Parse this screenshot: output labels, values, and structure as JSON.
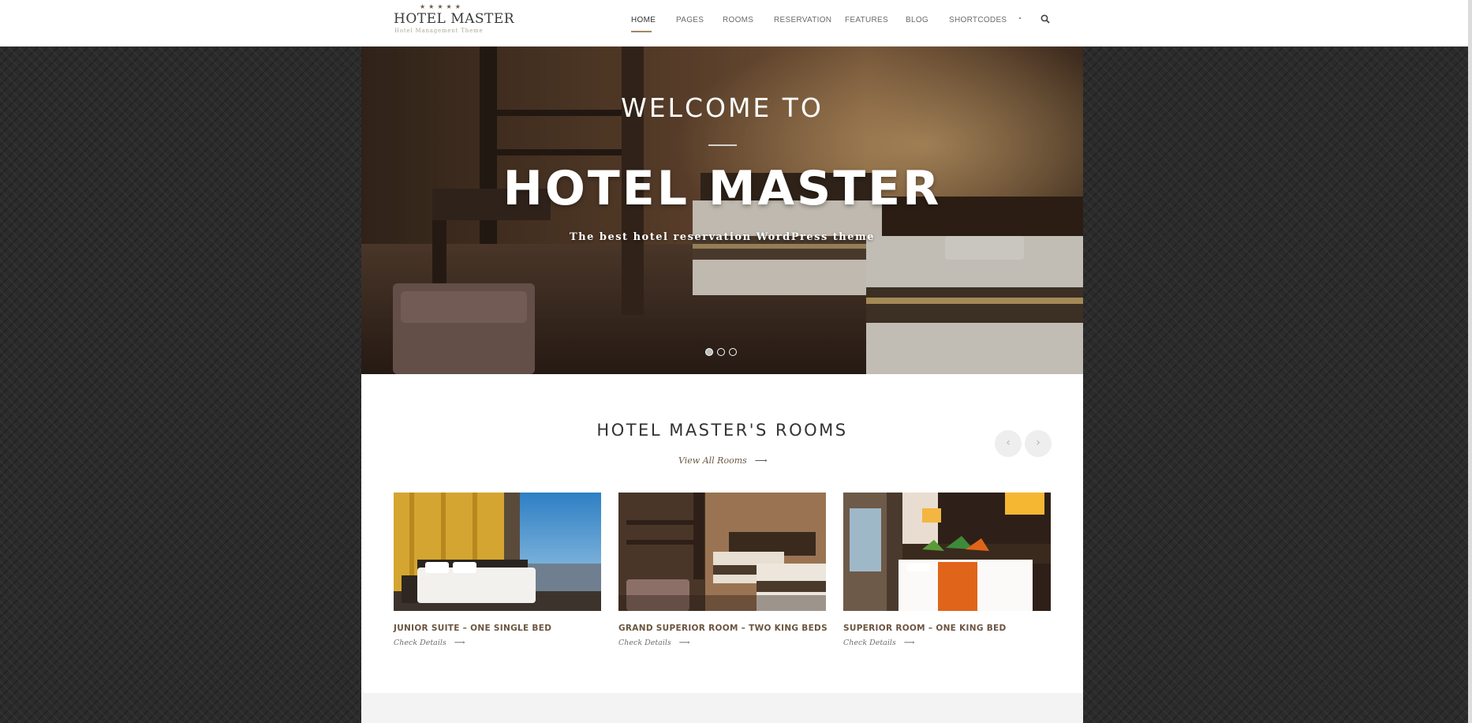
{
  "header": {
    "logo": {
      "stars": "★★★★★",
      "brand": "HOTEL MASTER",
      "tagline": "Hotel Management Theme"
    },
    "nav": [
      {
        "label": "HOME",
        "active": true
      },
      {
        "label": "PAGES"
      },
      {
        "label": "ROOMS"
      },
      {
        "label": "RESERVATION"
      },
      {
        "label": "FEATURES"
      },
      {
        "label": "BLOG"
      },
      {
        "label": "SHORTCODES"
      }
    ],
    "search_icon": "search-icon"
  },
  "hero": {
    "pre_title": "WELCOME TO",
    "title": "HOTEL MASTER",
    "subtitle": "The best hotel reservation WordPress theme",
    "slides": 3,
    "active_slide": 1
  },
  "rooms_section": {
    "title": "HOTEL MASTER'S ROOMS",
    "view_all": "View All Rooms",
    "arrow": "⟶",
    "prev_icon": "chevron-left-icon",
    "next_icon": "chevron-right-icon",
    "rooms": [
      {
        "name": "JUNIOR SUITE – ONE SINGLE BED",
        "link": "Check Details"
      },
      {
        "name": "GRAND SUPERIOR ROOM – TWO KING BEDS",
        "link": "Check Details"
      },
      {
        "name": "SUPERIOR ROOM – ONE KING BED",
        "link": "Check Details"
      }
    ]
  },
  "colors": {
    "accent": "#a38663",
    "room_title": "#6b5540",
    "background": "#2b2b2b"
  }
}
